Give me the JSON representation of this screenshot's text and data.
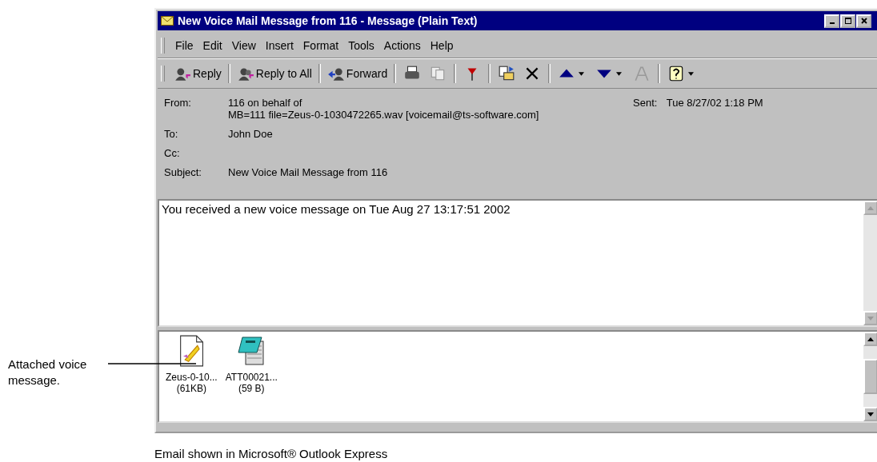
{
  "window": {
    "title": "New Voice Mail Message from 116 - Message (Plain Text)"
  },
  "menu": [
    "File",
    "Edit",
    "View",
    "Insert",
    "Format",
    "Tools",
    "Actions",
    "Help"
  ],
  "toolbar": {
    "buttons": [
      "Reply",
      "Reply to All",
      "Forward"
    ],
    "tools": [
      {
        "disabled": false,
        "dropdown": false
      },
      {
        "disabled": true,
        "dropdown": false
      },
      {
        "disabled": false,
        "dropdown": false
      },
      {
        "disabled": false,
        "dropdown": false
      },
      {
        "disabled": false,
        "dropdown": false
      },
      {
        "disabled": false,
        "dropdown": true
      },
      {
        "disabled": false,
        "dropdown": true
      },
      {
        "disabled": true,
        "dropdown": false
      },
      {
        "disabled": false,
        "dropdown": true
      }
    ]
  },
  "header": {
    "fields": [
      {
        "label": "From:",
        "lines": [
          "116 on behalf of",
          "MB=111 file=Zeus-0-1030472265.wav [voicemail@ts-software.com]"
        ]
      },
      {
        "label": "To:",
        "lines": [
          "John Doe"
        ]
      },
      {
        "label": "Cc:"
      },
      {
        "label": "Subject:",
        "lines": [
          "New Voice Mail Message from 116"
        ]
      }
    ],
    "sent": {
      "label": "Sent:",
      "value": "Tue 8/27/02 1:18 PM"
    }
  },
  "body": "You received a new voice message on Tue Aug 27 13:17:51 2002",
  "attachments": [
    {
      "kind": "sound",
      "name": "Zeus-0-10...",
      "size": "(61KB)"
    },
    {
      "kind": "notepad",
      "name": "ATT00021...",
      "size": "(59 B)"
    }
  ],
  "annotation": {
    "text": "Attached voice message."
  },
  "caption": "Email shown in Microsoft® Outlook Express"
}
